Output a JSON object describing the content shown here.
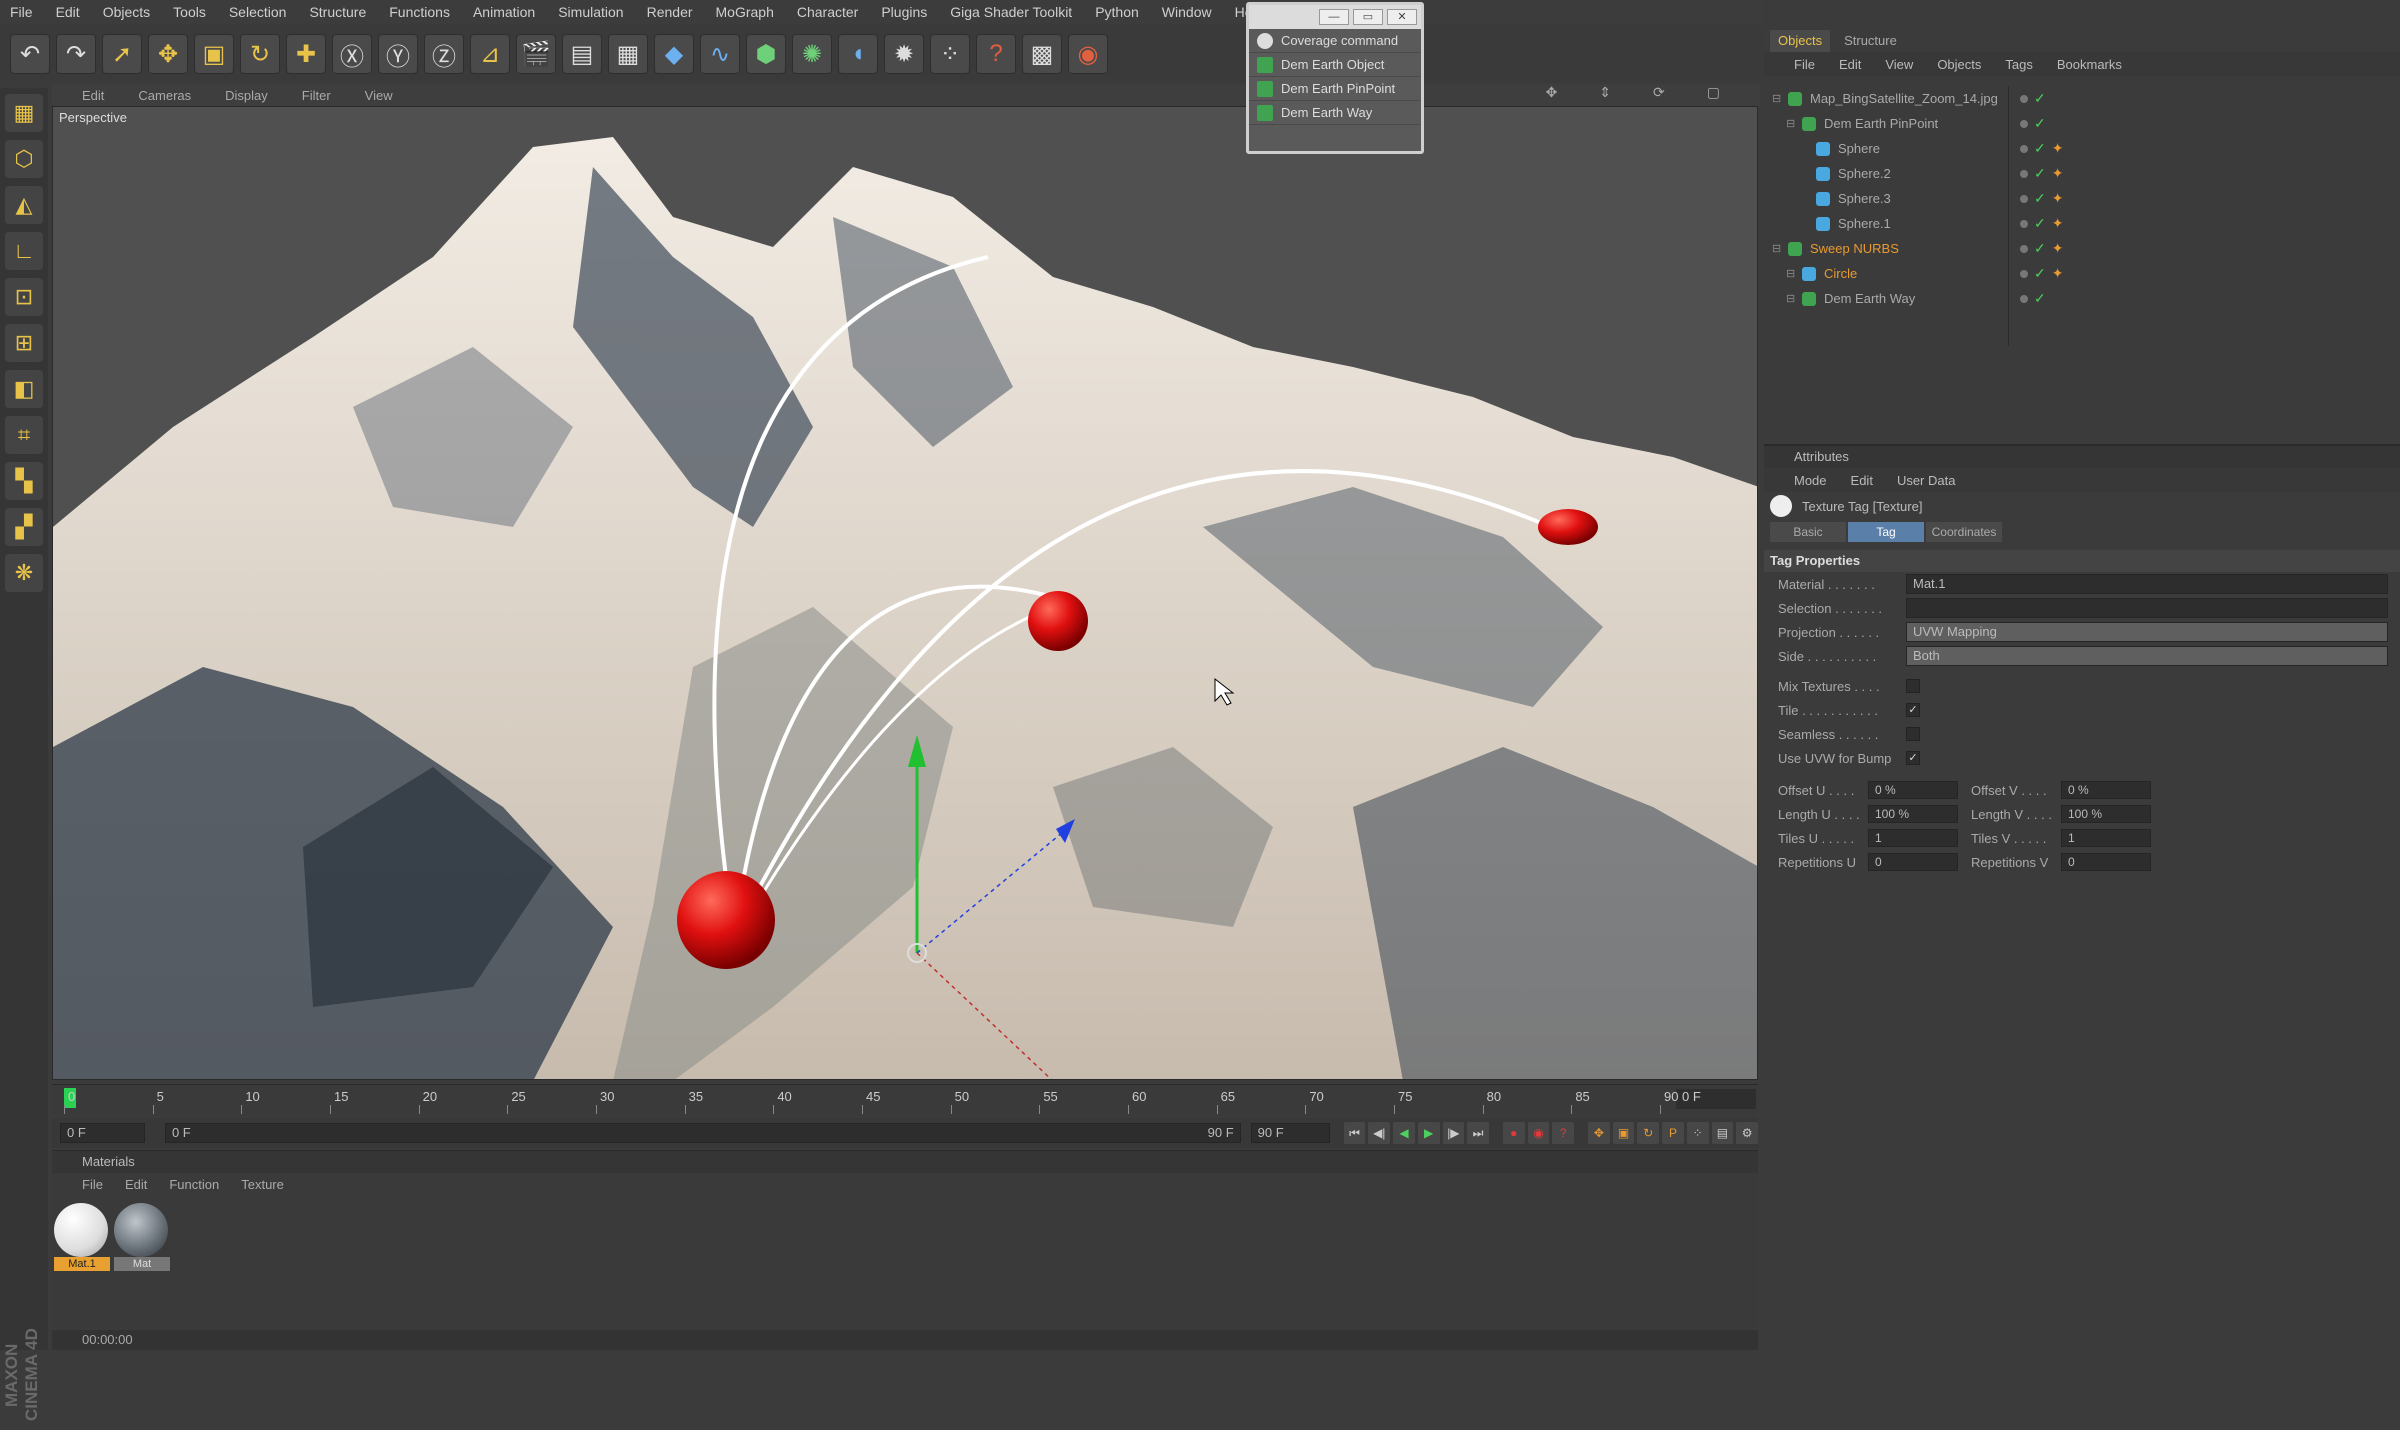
{
  "menu": [
    "File",
    "Edit",
    "Objects",
    "Tools",
    "Selection",
    "Structure",
    "Functions",
    "Animation",
    "Simulation",
    "Render",
    "MoGraph",
    "Character",
    "Plugins",
    "Giga Shader Toolkit",
    "Python",
    "Window",
    "Help"
  ],
  "viewport": {
    "menu": [
      "Edit",
      "Cameras",
      "Display",
      "Filter",
      "View"
    ],
    "label": "Perspective"
  },
  "popup": {
    "items": [
      "Coverage command",
      "Dem Earth Object",
      "Dem Earth PinPoint",
      "Dem Earth Way"
    ]
  },
  "timeline": {
    "ticks": [
      "0",
      "5",
      "10",
      "15",
      "20",
      "25",
      "30",
      "35",
      "40",
      "45",
      "50",
      "55",
      "60",
      "65",
      "70",
      "75",
      "80",
      "85",
      "90"
    ],
    "end_frame": "0 F",
    "start_field": "0 F",
    "range_start": "0 F",
    "range_end": "90 F",
    "max_field": "90 F"
  },
  "materials": {
    "title": "Materials",
    "menu": [
      "File",
      "Edit",
      "Function",
      "Texture"
    ],
    "items": [
      {
        "label": "Mat.1"
      },
      {
        "label": "Mat"
      }
    ]
  },
  "status": {
    "time": "00:00:00"
  },
  "brand": "MAXON CINEMA 4D",
  "objects": {
    "tabs": [
      "Objects",
      "Structure"
    ],
    "menu": [
      "File",
      "Edit",
      "View",
      "Objects",
      "Tags",
      "Bookmarks"
    ],
    "tree": [
      {
        "name": "Map_BingSatellite_Zoom_14.jpg",
        "indent": 0,
        "color": "#3fa34f"
      },
      {
        "name": "Dem Earth PinPoint",
        "indent": 1,
        "color": "#3fa34f"
      },
      {
        "name": "Sphere",
        "indent": 2,
        "color": "#4aa8e0"
      },
      {
        "name": "Sphere.2",
        "indent": 2,
        "color": "#4aa8e0"
      },
      {
        "name": "Sphere.3",
        "indent": 2,
        "color": "#4aa8e0"
      },
      {
        "name": "Sphere.1",
        "indent": 2,
        "color": "#4aa8e0"
      },
      {
        "name": "Sweep NURBS",
        "indent": 0,
        "color": "#3fa34f",
        "orange": true
      },
      {
        "name": "Circle",
        "indent": 1,
        "color": "#4aa8e0",
        "orange": true
      },
      {
        "name": "Dem Earth Way",
        "indent": 1,
        "color": "#3fa34f"
      }
    ]
  },
  "attributes": {
    "title": "Attributes",
    "menu": [
      "Mode",
      "Edit",
      "User Data"
    ],
    "object": "Texture Tag [Texture]",
    "tabs": [
      "Basic",
      "Tag",
      "Coordinates"
    ],
    "section": "Tag Properties",
    "props": [
      {
        "label": "Material . . . . . . .",
        "value": "Mat.1"
      },
      {
        "label": "Selection . . . . . . .",
        "value": ""
      },
      {
        "label": "Projection . . . . . .",
        "value": "UVW Mapping"
      },
      {
        "label": "Side . . . . . . . . . .",
        "value": "Both"
      }
    ],
    "checks": [
      {
        "label": "Mix Textures . . . .",
        "checked": false
      },
      {
        "label": "Tile . . . . . . . . . . .",
        "checked": true
      },
      {
        "label": "Seamless . . . . . .",
        "checked": false
      },
      {
        "label": "Use UVW for Bump",
        "checked": true
      }
    ],
    "grid": [
      {
        "label": "Offset U . . . .",
        "value": "0 %"
      },
      {
        "label": "Offset V . . . .",
        "value": "0 %"
      },
      {
        "label": "Length U . . . .",
        "value": "100 %"
      },
      {
        "label": "Length V . . . .",
        "value": "100 %"
      },
      {
        "label": "Tiles U . . . . .",
        "value": "1"
      },
      {
        "label": "Tiles V . . . . .",
        "value": "1"
      },
      {
        "label": "Repetitions U",
        "value": "0"
      },
      {
        "label": "Repetitions V",
        "value": "0"
      }
    ]
  }
}
